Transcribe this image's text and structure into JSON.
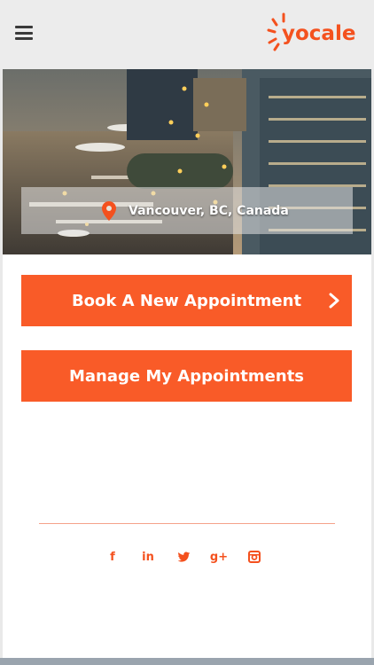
{
  "header": {
    "menu_icon": "hamburger-icon",
    "logo_text": "yocale"
  },
  "hero": {
    "location": "Vancouver, BC, Canada",
    "location_icon": "map-pin-icon"
  },
  "actions": {
    "book_label": "Book A New Appointment",
    "manage_label": "Manage My Appointments"
  },
  "footer": {
    "social_icons": [
      "facebook-icon",
      "linkedin-icon",
      "twitter-icon",
      "google-plus-icon",
      "instagram-icon"
    ]
  },
  "colors": {
    "accent": "#f95b28",
    "header_bg": "#ececec",
    "menu_icon": "#3a3a3a"
  }
}
